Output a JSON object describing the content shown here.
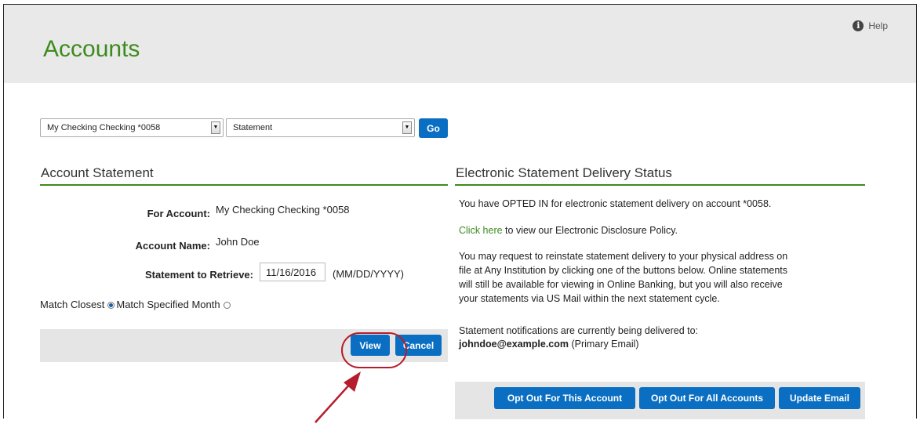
{
  "header": {
    "title": "Accounts",
    "help_label": "Help",
    "help_icon": "i"
  },
  "toolbar": {
    "account_select": "My Checking Checking *0058",
    "action_select": "Statement",
    "go_label": "Go"
  },
  "statement": {
    "section_title": "Account Statement",
    "for_account_label": "For Account:",
    "for_account_value": "My Checking Checking *0058",
    "account_name_label": "Account Name:",
    "account_name_value": "John Doe",
    "retrieve_label": "Statement to Retrieve:",
    "retrieve_date": "11/16/2016",
    "date_format": "(MM/DD/YYYY)",
    "match_closest": "Match Closest",
    "match_month": "Match Specified Month",
    "view_label": "View",
    "cancel_label": "Cancel"
  },
  "delivery": {
    "section_title": "Electronic Statement Delivery Status",
    "opted_in_text": "You have OPTED IN for electronic statement delivery on account *0058.",
    "click_here": "Click here",
    "policy_text": " to view our Electronic Disclosure Policy.",
    "reinstate_lines": [
      "You may request to reinstate statement delivery to your physical address on",
      "file at Any Institution by clicking one of the buttons below. Online statements",
      "will still be available for viewing in Online Banking, but you will also receive",
      "your statements via US Mail within the next statement cycle."
    ],
    "notifications_text": "Statement notifications are currently being delivered to:",
    "email": "johndoe@example.com",
    "email_type": " (Primary Email)",
    "opt_out_account": "Opt Out For This Account",
    "opt_out_all": "Opt Out For All Accounts",
    "update_email": "Update Email"
  },
  "colors": {
    "brand_green": "#3d8b1f",
    "button_blue": "#0a6fc2",
    "annotation_red": "#b71c2c"
  }
}
